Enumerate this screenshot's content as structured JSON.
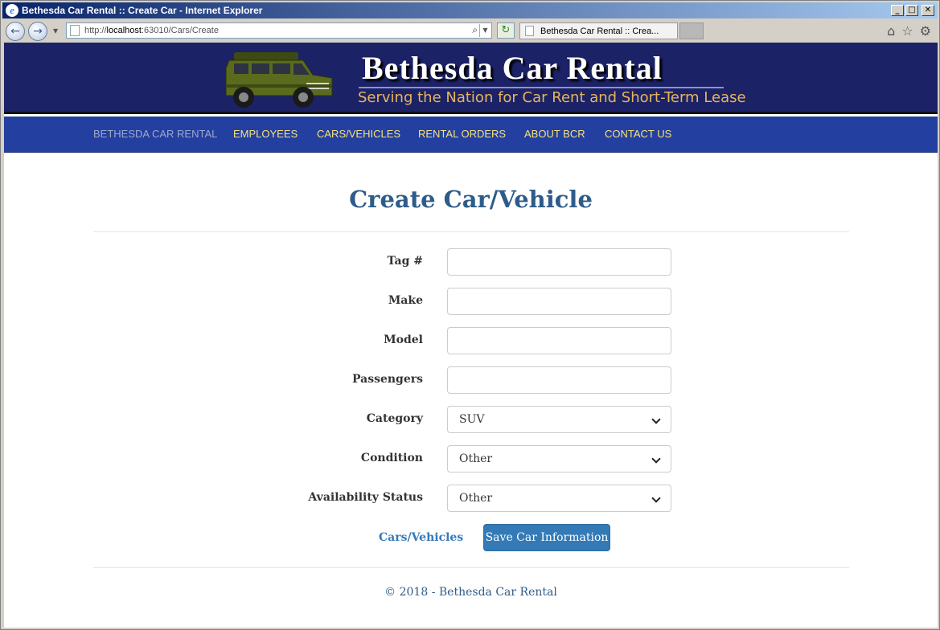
{
  "window": {
    "title": "Bethesda Car Rental :: Create Car - Internet Explorer",
    "minimize_label": "_",
    "maximize_label": "□",
    "close_label": "✕"
  },
  "browser": {
    "url_prefix": "http://",
    "url_host": "localhost",
    "url_rest": ":63010/Cars/Create",
    "tab_title": "Bethesda Car Rental :: Crea...",
    "back_glyph": "←",
    "forward_glyph": "→",
    "dropdown_glyph": "▼",
    "search_glyph": "⌕",
    "refresh_glyph": "↻",
    "home_glyph": "⌂",
    "favorites_glyph": "☆",
    "tools_glyph": "⚙"
  },
  "banner": {
    "title": "Bethesda Car Rental",
    "tagline": "Serving the Nation for Car Rent and Short-Term Lease",
    "car_body_color": "#5a6b1e"
  },
  "nav": {
    "brand": "BETHESDA CAR RENTAL",
    "items": [
      "EMPLOYEES",
      "CARS/VEHICLES",
      "RENTAL ORDERS",
      "ABOUT BCR",
      "CONTACT US"
    ]
  },
  "page": {
    "title": "Create Car/Vehicle"
  },
  "form": {
    "fields": [
      {
        "label": "Tag #",
        "value": ""
      },
      {
        "label": "Make",
        "value": ""
      },
      {
        "label": "Model",
        "value": ""
      },
      {
        "label": "Passengers",
        "value": ""
      }
    ],
    "selects": [
      {
        "label": "Category",
        "value": "SUV"
      },
      {
        "label": "Condition",
        "value": "Other"
      },
      {
        "label": "Availability Status",
        "value": "Other"
      }
    ],
    "back_link": "Cars/Vehicles",
    "submit_label": "Save Car Information"
  },
  "footer": {
    "text": "© 2018 - Bethesda Car Rental"
  },
  "colors": {
    "banner_bg": "#1c2266",
    "navbar_bg": "#2340a0",
    "nav_text": "#f8e27a",
    "title_blue": "#2e5c8a",
    "button_blue": "#337ab7",
    "tagline_gold": "#e8b55c"
  }
}
